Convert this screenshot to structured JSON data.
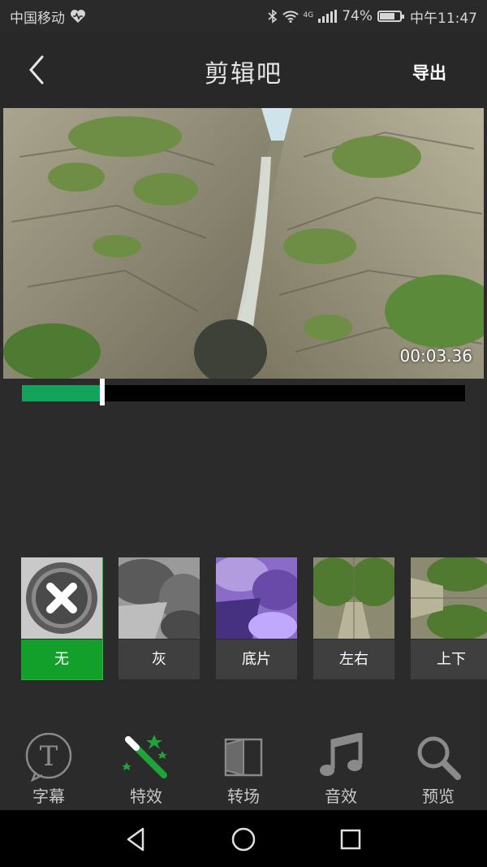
{
  "status_bar": {
    "carrier": "中国移动",
    "network": "4G",
    "battery": "74%",
    "battery_level": 0.74,
    "time": "中午11:47"
  },
  "header": {
    "title": "剪辑吧",
    "export_label": "导出"
  },
  "player": {
    "timecode": "00:03.36",
    "progress": 0.18
  },
  "filters": [
    {
      "label": "无",
      "selected": true
    },
    {
      "label": "灰",
      "selected": false
    },
    {
      "label": "底片",
      "selected": false
    },
    {
      "label": "左右",
      "selected": false
    },
    {
      "label": "上下",
      "selected": false
    }
  ],
  "toolbar": [
    {
      "label": "字幕",
      "icon": "subtitle-icon"
    },
    {
      "label": "特效",
      "icon": "magic-wand-icon",
      "active": true
    },
    {
      "label": "转场",
      "icon": "transition-icon"
    },
    {
      "label": "音效",
      "icon": "music-note-icon"
    },
    {
      "label": "预览",
      "icon": "magnifier-icon"
    }
  ],
  "colors": {
    "accent_green": "#12a02a",
    "progress_green": "#13a35a",
    "background": "#2b2b2b"
  }
}
